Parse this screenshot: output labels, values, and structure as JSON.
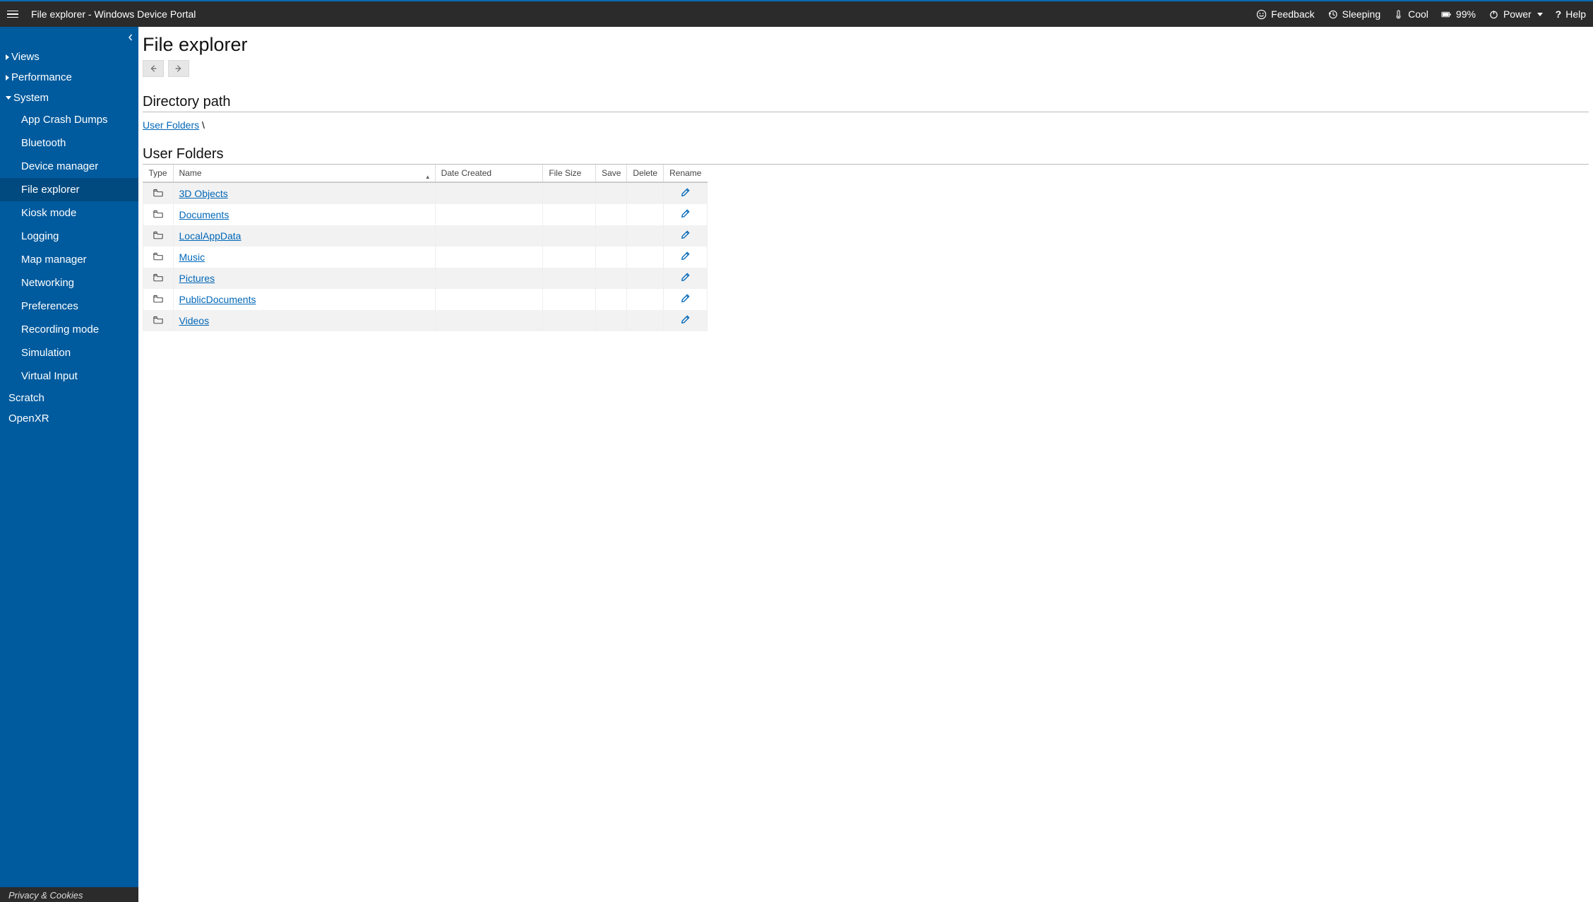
{
  "topbar": {
    "title": "File explorer - Windows Device Portal",
    "feedback": "Feedback",
    "sleeping": "Sleeping",
    "cool": "Cool",
    "battery": "99%",
    "power": "Power",
    "help": "Help"
  },
  "sidebar": {
    "groups": [
      {
        "label": "Views",
        "expanded": false,
        "children": []
      },
      {
        "label": "Performance",
        "expanded": false,
        "children": []
      },
      {
        "label": "System",
        "expanded": true,
        "children": [
          {
            "label": "App Crash Dumps",
            "active": false
          },
          {
            "label": "Bluetooth",
            "active": false
          },
          {
            "label": "Device manager",
            "active": false
          },
          {
            "label": "File explorer",
            "active": true
          },
          {
            "label": "Kiosk mode",
            "active": false
          },
          {
            "label": "Logging",
            "active": false
          },
          {
            "label": "Map manager",
            "active": false
          },
          {
            "label": "Networking",
            "active": false
          },
          {
            "label": "Preferences",
            "active": false
          },
          {
            "label": "Recording mode",
            "active": false
          },
          {
            "label": "Simulation",
            "active": false
          },
          {
            "label": "Virtual Input",
            "active": false
          }
        ]
      }
    ],
    "plain": [
      {
        "label": "Scratch"
      },
      {
        "label": "OpenXR"
      }
    ],
    "footer": "Privacy & Cookies"
  },
  "content": {
    "page_title": "File explorer",
    "directory_path_heading": "Directory path",
    "breadcrumb_root": "User Folders",
    "breadcrumb_sep": "\\",
    "folder_heading": "User Folders",
    "columns": {
      "type": "Type",
      "name": "Name",
      "date": "Date Created",
      "size": "File Size",
      "save": "Save",
      "delete": "Delete",
      "rename": "Rename"
    },
    "rows": [
      {
        "name": "3D Objects"
      },
      {
        "name": "Documents"
      },
      {
        "name": "LocalAppData"
      },
      {
        "name": "Music"
      },
      {
        "name": "Pictures"
      },
      {
        "name": "PublicDocuments"
      },
      {
        "name": "Videos"
      }
    ]
  }
}
